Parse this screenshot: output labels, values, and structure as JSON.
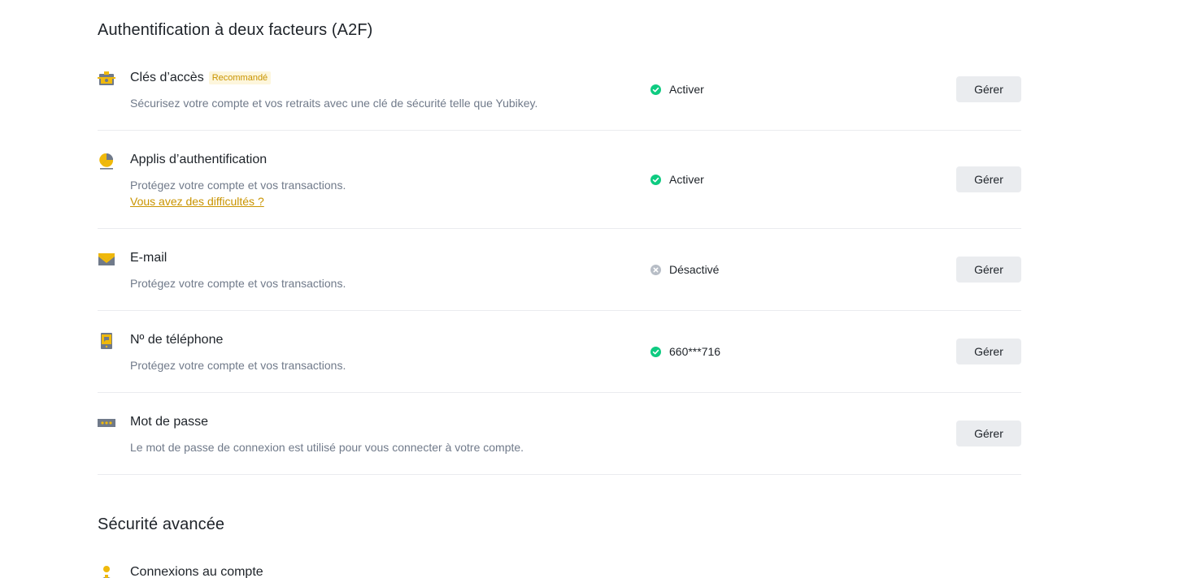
{
  "sections": {
    "two_factor_title": "Authentification à deux facteurs (A2F)",
    "advanced_title": "Sécurité avancée"
  },
  "rows": [
    {
      "title": "Clés d’accès",
      "badge": "Recommandé",
      "description": "Sécurisez votre compte et vos retraits avec une clé de sécurité telle que Yubikey.",
      "status": "Activer",
      "status_state": "enabled",
      "icon": "passkey-icon",
      "button": "Gérer"
    },
    {
      "title": "Applis d’authentification",
      "description": "Protégez votre compte et vos transactions.",
      "link": "Vous avez des difficultés ?",
      "status": "Activer",
      "status_state": "enabled",
      "icon": "authenticator-icon",
      "button": "Gérer"
    },
    {
      "title": "E-mail",
      "description": "Protégez votre compte et vos transactions.",
      "status": "Désactivé",
      "status_state": "disabled",
      "icon": "email-icon",
      "button": "Gérer"
    },
    {
      "title": "Nº de téléphone",
      "description": "Protégez votre compte et vos transactions.",
      "status": "660***716",
      "status_state": "enabled",
      "icon": "phone-icon",
      "button": "Gérer"
    },
    {
      "title": "Mot de passe",
      "description": "Le mot de passe de connexion est utilisé pour vous connecter à votre compte.",
      "icon": "password-icon",
      "button": "Gérer"
    }
  ],
  "advanced": {
    "item_title": "Connexions au compte",
    "icon": "account-connections-icon"
  },
  "colors": {
    "accent": "#f0b90b",
    "link": "#c99400",
    "success": "#0ecb81",
    "disabled": "#b7bdc6",
    "button_bg": "#eaecef",
    "text_secondary": "#707a8a"
  }
}
